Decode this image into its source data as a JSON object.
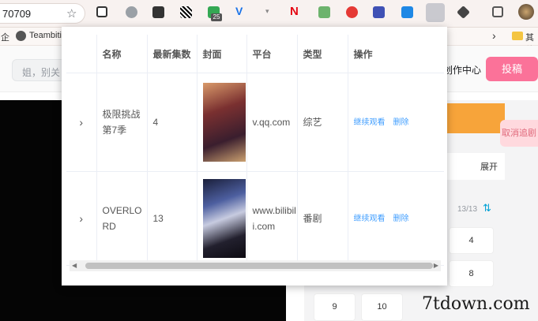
{
  "browser": {
    "address_text": "70709",
    "extension_badge": "25",
    "bookmarks": {
      "teambition_label": "Teambitio",
      "other_label": "其他"
    },
    "bookmark_chevron": "›"
  },
  "page": {
    "search_placeholder": "姐，别关",
    "creator_center": "创作中心",
    "post_button": "投稿",
    "cancel_follow": "取消追剧",
    "expand": "展开",
    "episode_progress": "13/13",
    "episodes": [
      "4",
      "8",
      "9",
      "10"
    ]
  },
  "popup": {
    "columns": [
      "名称",
      "最新集数",
      "封面",
      "平台",
      "类型",
      "操作"
    ],
    "rows": [
      {
        "name": "极限挑战第7季",
        "latest": "4",
        "platform": "v.qq.com",
        "type": "综艺",
        "continue": "继续观看",
        "delete": "删除"
      },
      {
        "name": "OVERLORD",
        "latest": "13",
        "platform": "www.bilibili.com",
        "type": "番剧",
        "continue": "继续观看",
        "delete": "删除"
      }
    ]
  },
  "watermark": "7tdown.com",
  "colors": {
    "link": "#409eff",
    "post_button": "#fb7299",
    "orange_bar": "#f7a43a"
  }
}
